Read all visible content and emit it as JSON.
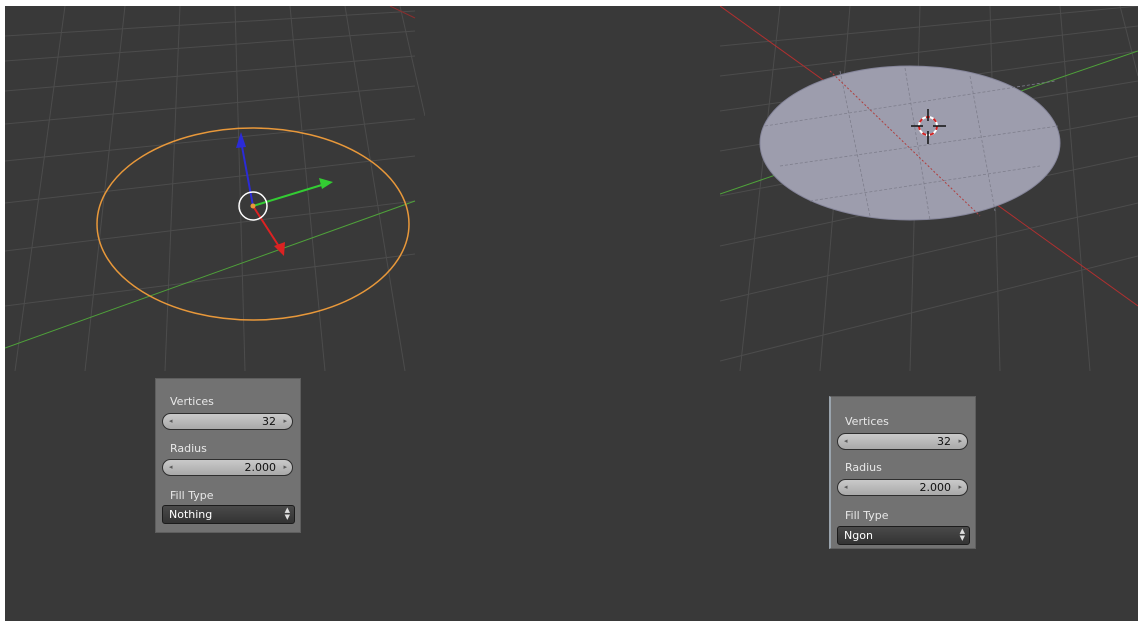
{
  "left_panel": {
    "vertices_label": "Vertices",
    "vertices_value": "32",
    "radius_label": "Radius",
    "radius_value": "2.000",
    "fill_type_label": "Fill Type",
    "fill_type_value": "Nothing"
  },
  "right_panel": {
    "vertices_label": "Vertices",
    "vertices_value": "32",
    "radius_label": "Radius",
    "radius_value": "2.000",
    "fill_type_label": "Fill Type",
    "fill_type_value": "Ngon"
  },
  "icons": {
    "arrow_left": "◂",
    "arrow_right": "▸",
    "select_up": "▲",
    "select_down": "▼"
  },
  "colors": {
    "background": "#393939",
    "grid": "#4d4d4d",
    "x_axis": "#c0392b",
    "y_axis": "#4fa23a",
    "circle_outline": "#e8983a",
    "filled_ngon": "#9d9dad",
    "gizmo_z": "#2b2bd8",
    "gizmo_y": "#33cc33",
    "gizmo_x": "#dd2222"
  }
}
